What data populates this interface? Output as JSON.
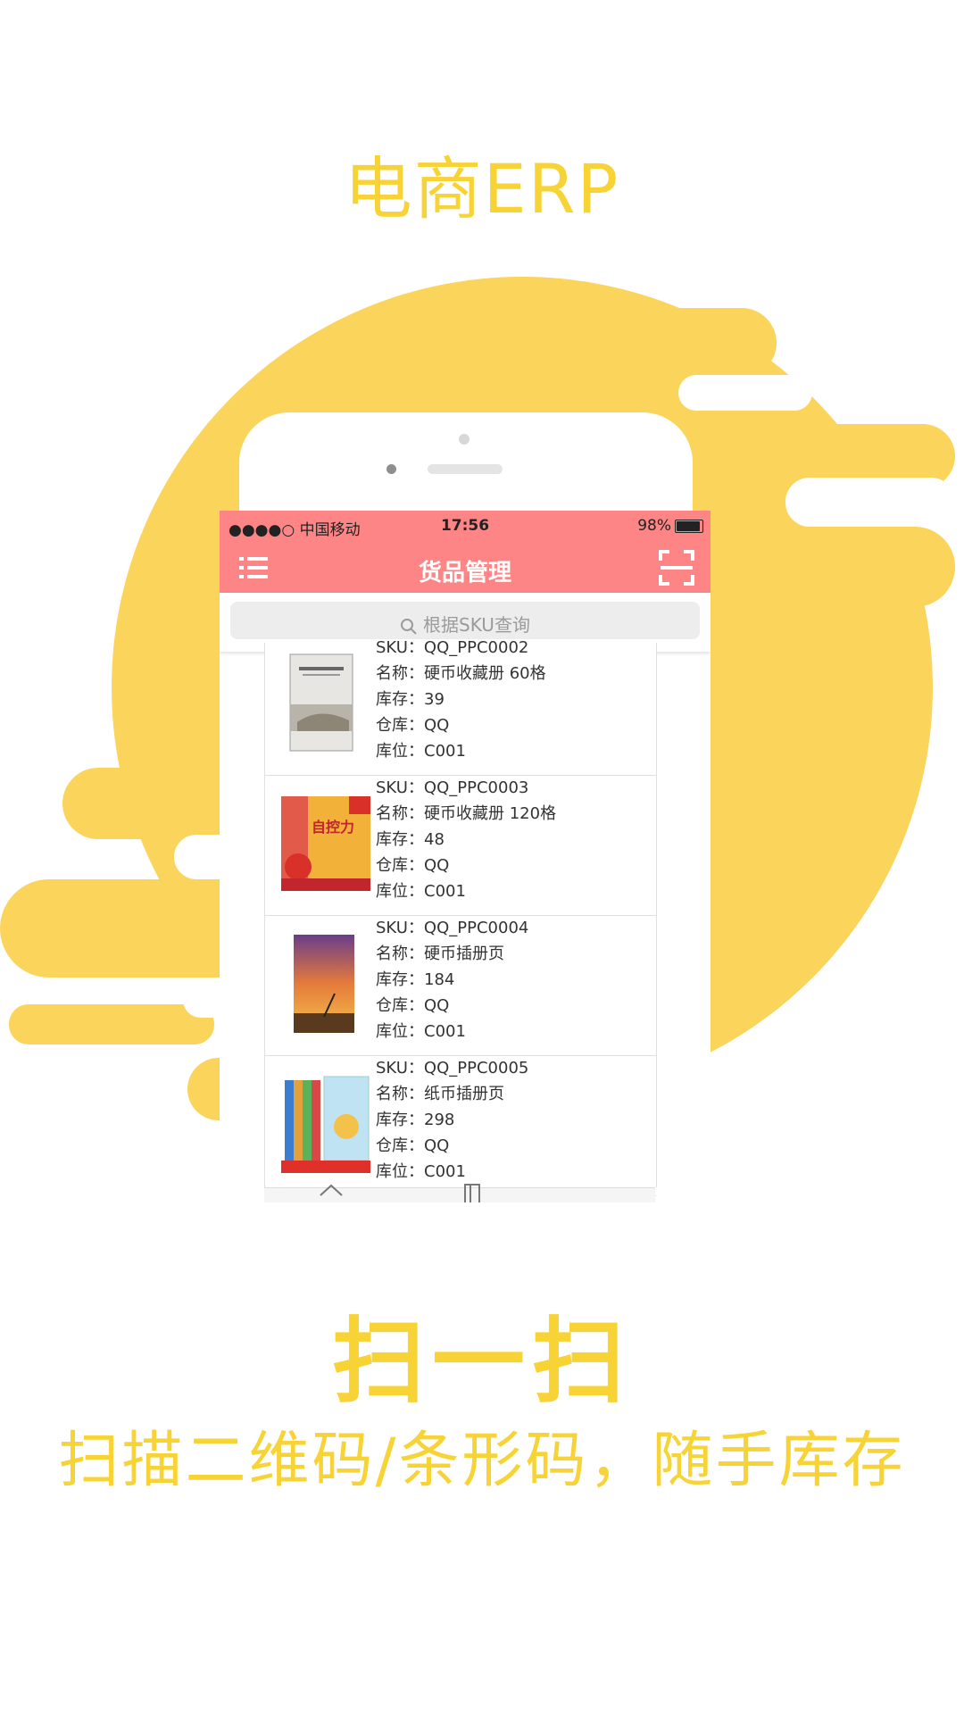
{
  "headline": "电商ERP",
  "colors": {
    "accent": "#f7d336",
    "navbar": "#fd8585"
  },
  "statusbar": {
    "carrier": "●●●●○ 中国移动",
    "time": "17:56",
    "battery": "98%"
  },
  "navbar": {
    "title": "货品管理",
    "menu_icon": "list-menu-icon",
    "scan_icon": "scan-qr-icon"
  },
  "search": {
    "placeholder": "根据SKU查询"
  },
  "items": [
    {
      "sku": "SKU：QQ_PPC0002",
      "name": "名称：硬币收藏册 60格",
      "stock": "库存：39",
      "warehouse": "仓库：QQ",
      "location": "库位：C001"
    },
    {
      "sku": "SKU：QQ_PPC0003",
      "name": "名称：硬币收藏册 120格",
      "stock": "库存：48",
      "warehouse": "仓库：QQ",
      "location": "库位：C001"
    },
    {
      "sku": "SKU：QQ_PPC0004",
      "name": "名称：硬币插册页",
      "stock": "库存：184",
      "warehouse": "仓库：QQ",
      "location": "库位：C001"
    },
    {
      "sku": "SKU：QQ_PPC0005",
      "name": "名称：纸币插册页",
      "stock": "库存：298",
      "warehouse": "仓库：QQ",
      "location": "库位：C001"
    }
  ],
  "book2_title": "自控力",
  "slogan_main": "扫一扫",
  "slogan_sub": "扫描二维码/条形码，随手库存"
}
